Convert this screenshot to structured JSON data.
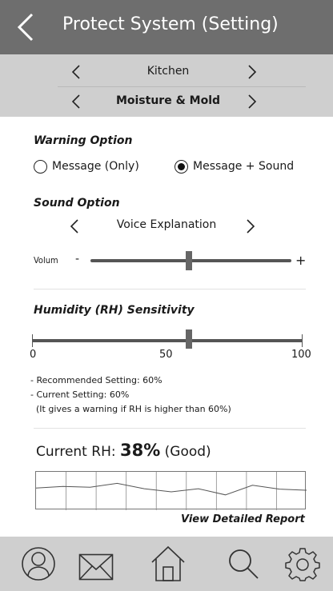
{
  "header": {
    "title": "Protect System (Setting)",
    "back_icon": "chevron-left-icon"
  },
  "selectors": {
    "room": "Kitchen",
    "category": "Moisture & Mold"
  },
  "warning_option": {
    "title": "Warning Option",
    "options": [
      "Message (Only)",
      "Message + Sound"
    ],
    "selected": "Message + Sound"
  },
  "sound_option": {
    "title": "Sound Option",
    "voice": "Voice Explanation",
    "volume_label": "Volum",
    "volume_minus": "-",
    "volume_plus": "+",
    "volume_level": 0.49
  },
  "humidity": {
    "title": "Humidity (RH) Sensitivity",
    "scale_min": "0",
    "scale_mid": "50",
    "scale_max": "100",
    "value": 58,
    "notes": [
      "- Recommended Setting: 60%",
      "- Current Setting: 60%",
      "  (It gives a warning if RH is higher than 60%)"
    ]
  },
  "current_rh": {
    "label": "Current RH:",
    "value": "38%",
    "status": "(Good)",
    "trend": [
      0.42,
      0.38,
      0.4,
      0.3,
      0.44,
      0.52,
      0.44,
      0.6,
      0.35,
      0.45,
      0.48
    ]
  },
  "report_link": "View Detailed Report",
  "bottom_nav": [
    "user-icon",
    "mail-icon",
    "home-icon",
    "search-icon",
    "settings-icon"
  ],
  "colors": {
    "header_bg": "#6e6e6e",
    "band_bg": "#cfcfcf",
    "slider": "#555555"
  }
}
